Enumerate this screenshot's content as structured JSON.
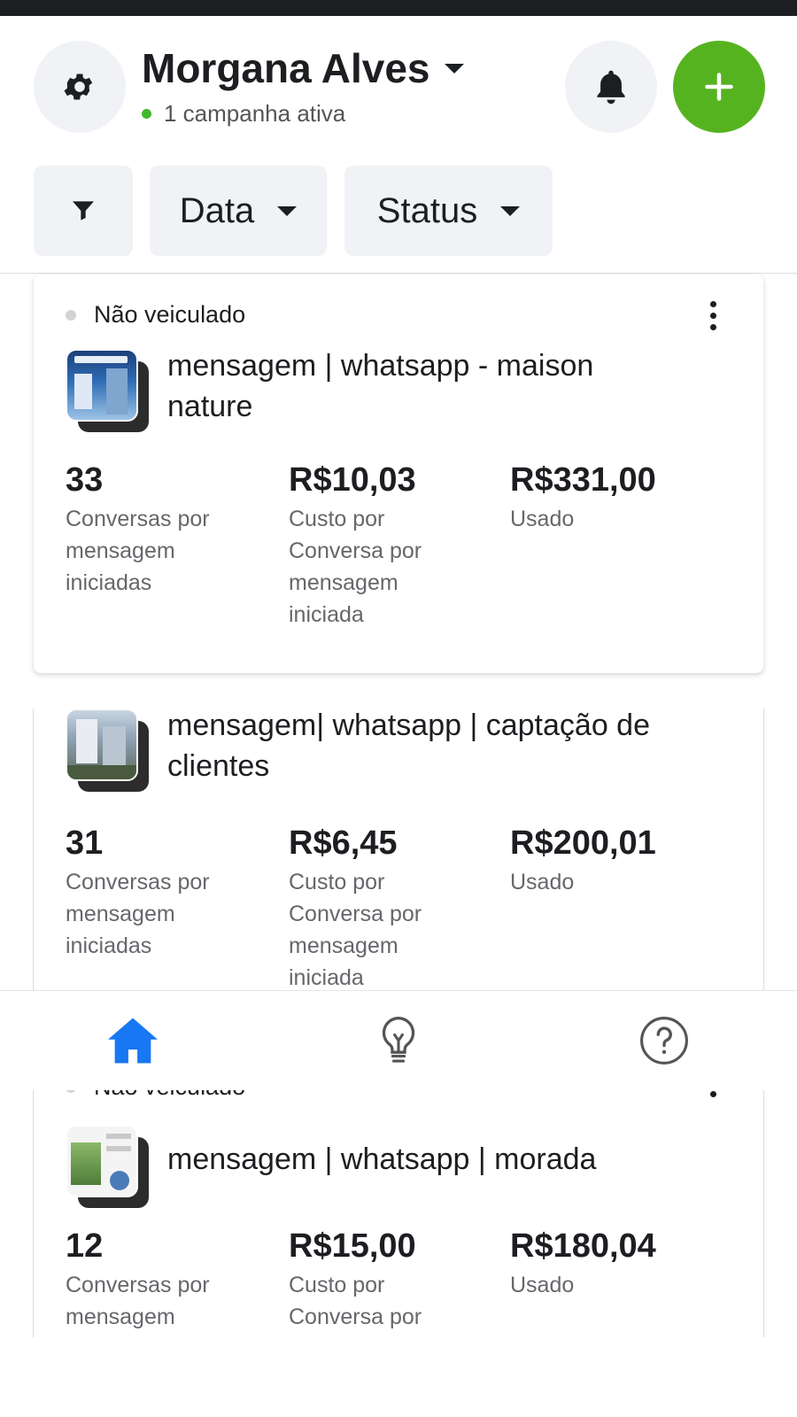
{
  "header": {
    "account_name": "Morgana Alves",
    "active_text": "1 campanha ativa"
  },
  "filters": {
    "date_label": "Data",
    "status_label": "Status"
  },
  "ads": [
    {
      "status": "Não veiculado",
      "title_line1": "mensagem | whatsapp  - maison",
      "title_line2": "nature",
      "metrics": [
        {
          "value": "33",
          "label": "Conversas por mensagem iniciadas"
        },
        {
          "value": "R$10,03",
          "label": "Custo por Conversa por mensagem iniciada"
        },
        {
          "value": "R$331,00",
          "label": "Usado"
        }
      ]
    },
    {
      "status": "",
      "title_line1": "mensagem| whatsapp | captação de",
      "title_line2": "clientes",
      "metrics": [
        {
          "value": "31",
          "label": "Conversas por mensagem iniciadas"
        },
        {
          "value": "R$6,45",
          "label": "Custo por Conversa por mensagem iniciada"
        },
        {
          "value": "R$200,01",
          "label": "Usado"
        }
      ]
    },
    {
      "status": "Não veiculado",
      "title_line1": "mensagem | whatsapp | morada",
      "title_line2": "",
      "metrics": [
        {
          "value": "12",
          "label": "Conversas por mensagem"
        },
        {
          "value": "R$15,00",
          "label": "Custo por Conversa por"
        },
        {
          "value": "R$180,04",
          "label": "Usado"
        }
      ]
    }
  ],
  "colors": {
    "accent_green": "#56b320",
    "nav_active_blue": "#1877f2",
    "status_dot_grey": "#d3d3d3"
  },
  "icons": {
    "settings": "gear-icon",
    "notifications": "bell-icon",
    "create": "plus-icon",
    "filter": "filter-icon",
    "home": "home-icon",
    "tips": "lightbulb-icon",
    "help": "help-icon"
  }
}
